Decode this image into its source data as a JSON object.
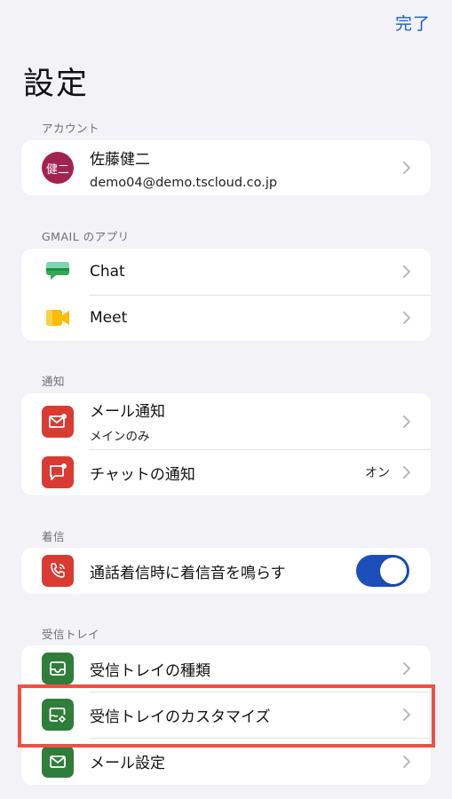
{
  "header": {
    "done_label": "完了",
    "title": "設定"
  },
  "sections": {
    "account": {
      "header": "アカウント",
      "name": "佐藤健二",
      "email": "demo04@demo.tscloud.co.jp",
      "avatar_text": "健二",
      "avatar_color": "#a1234f"
    },
    "gmail_apps": {
      "header": "GMAIL のアプリ",
      "items": [
        {
          "label": "Chat",
          "icon": "chat-app-icon"
        },
        {
          "label": "Meet",
          "icon": "meet-app-icon"
        }
      ]
    },
    "notifications": {
      "header": "通知",
      "items": [
        {
          "label": "メール通知",
          "sub": "メインのみ",
          "icon": "mail-notification-icon"
        },
        {
          "label": "チャットの通知",
          "value": "オン",
          "icon": "chat-notification-icon"
        }
      ]
    },
    "ringtone": {
      "header": "着信",
      "items": [
        {
          "label": "通話着信時に着信音を鳴らす",
          "toggle_on": true,
          "icon": "phone-ring-icon"
        }
      ]
    },
    "inbox": {
      "header": "受信トレイ",
      "items": [
        {
          "label": "受信トレイの種類",
          "icon": "inbox-icon"
        },
        {
          "label": "受信トレイのカスタマイズ",
          "icon": "inbox-customize-icon",
          "highlighted": true
        },
        {
          "label": "メール設定",
          "icon": "mail-settings-icon"
        }
      ]
    }
  },
  "colors": {
    "accent_blue": "#1a5bd7",
    "toggle_on": "#1d4fba",
    "tile_red": "#d93b32",
    "tile_green": "#2f7d3a",
    "highlight": "#ef5046",
    "background": "#f2f2f7"
  }
}
